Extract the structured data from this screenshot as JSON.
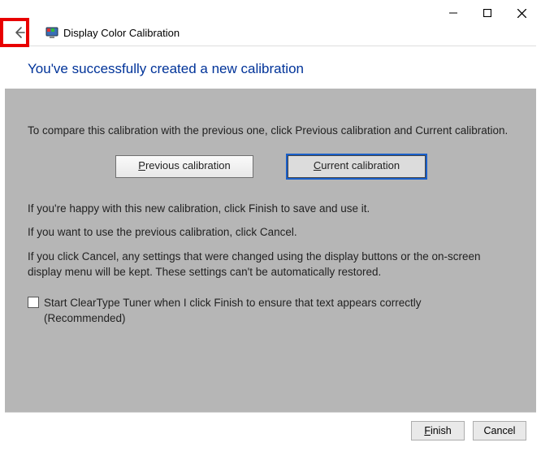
{
  "window": {
    "app_title": "Display Color Calibration"
  },
  "heading": "You've successfully created a new calibration",
  "content": {
    "compare_intro": "To compare this calibration with the previous one, click Previous calibration and Current calibration.",
    "btn_previous": "Previous calibration",
    "btn_current": "Current calibration",
    "happy_line": "If you're happy with this new calibration, click Finish to save and use it.",
    "cancel_line": "If you want to use the previous calibration, click Cancel.",
    "warn_line": "If you click Cancel, any settings that were changed using the display buttons or the on-screen display menu will be kept. These settings can't be automatically restored.",
    "checkbox_label": "Start ClearType Tuner when I click Finish to ensure that text appears correctly (Recommended)"
  },
  "footer": {
    "finish": "Finish",
    "cancel": "Cancel"
  }
}
